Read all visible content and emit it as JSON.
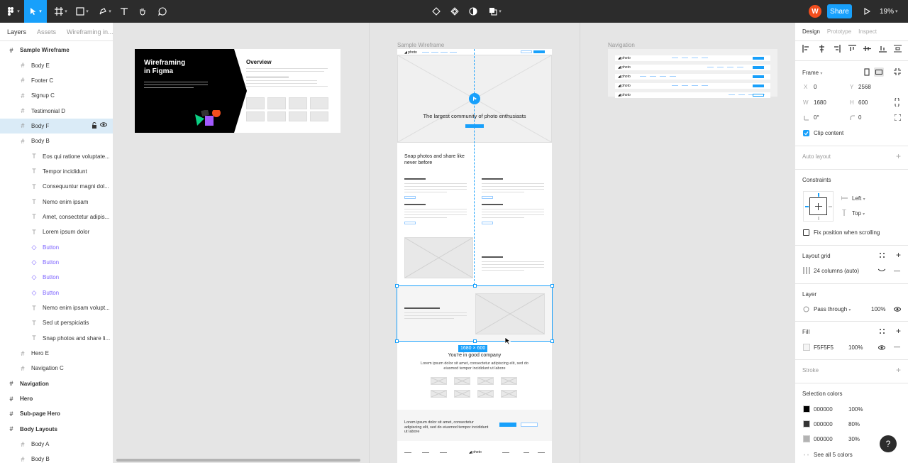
{
  "toolbar": {
    "avatar_initial": "W",
    "share_label": "Share",
    "zoom": "19%"
  },
  "left_panel": {
    "tabs": [
      "Layers",
      "Assets",
      "Wireframing in..."
    ],
    "layers": [
      {
        "name": "Sample Wireframe",
        "icon": "#",
        "kind": "top"
      },
      {
        "name": "Body E",
        "icon": "#",
        "kind": "frame"
      },
      {
        "name": "Footer C",
        "icon": "#",
        "kind": "frame"
      },
      {
        "name": "Signup C",
        "icon": "#",
        "kind": "frame"
      },
      {
        "name": "Testimonial D",
        "icon": "#",
        "kind": "frame"
      },
      {
        "name": "Body F",
        "icon": "#",
        "kind": "frame",
        "selected": true
      },
      {
        "name": "Body B",
        "icon": "#",
        "kind": "frame"
      },
      {
        "name": "Eos qui ratione voluptate...",
        "icon": "T",
        "kind": "text"
      },
      {
        "name": "Tempor incididunt",
        "icon": "T",
        "kind": "text"
      },
      {
        "name": "Consequuntur magni dol...",
        "icon": "T",
        "kind": "text"
      },
      {
        "name": "Nemo enim ipsam",
        "icon": "T",
        "kind": "text"
      },
      {
        "name": "Amet, consectetur adipis...",
        "icon": "T",
        "kind": "text"
      },
      {
        "name": "Lorem ipsum dolor",
        "icon": "T",
        "kind": "text"
      },
      {
        "name": "Button",
        "icon": "◇",
        "kind": "comp"
      },
      {
        "name": "Button",
        "icon": "◇",
        "kind": "comp"
      },
      {
        "name": "Button",
        "icon": "◇",
        "kind": "comp"
      },
      {
        "name": "Button",
        "icon": "◇",
        "kind": "comp"
      },
      {
        "name": "Nemo enim ipsam volupt...",
        "icon": "T",
        "kind": "text"
      },
      {
        "name": "Sed ut perspiciatis",
        "icon": "T",
        "kind": "text"
      },
      {
        "name": "Snap photos and share li...",
        "icon": "T",
        "kind": "text"
      },
      {
        "name": "Hero E",
        "icon": "#",
        "kind": "frame"
      },
      {
        "name": "Navigation C",
        "icon": "#",
        "kind": "frame"
      },
      {
        "name": "Navigation",
        "icon": "#",
        "kind": "top"
      },
      {
        "name": "Hero",
        "icon": "#",
        "kind": "top"
      },
      {
        "name": "Sub-page Hero",
        "icon": "#",
        "kind": "top"
      },
      {
        "name": "Body Layouts",
        "icon": "#",
        "kind": "top"
      },
      {
        "name": "Body A",
        "icon": "#",
        "kind": "frame"
      },
      {
        "name": "Body B",
        "icon": "#",
        "kind": "frame"
      }
    ]
  },
  "canvas": {
    "cover": {
      "title_line1": "Wireframing",
      "title_line2": "in Figma",
      "overview": "Overview"
    },
    "sample_label": "Sample Wireframe",
    "navigation_label": "Navigation",
    "nav_logos": [
      "photo",
      "photo",
      "photo",
      "photo",
      "photo"
    ],
    "hero_headline": "The largest community of photo enthusiasts",
    "snap_heading": "Snap photos and share like never before",
    "selection_size": "1680 × 600",
    "good_company": "You're in good company",
    "good_company_sub": "Lorem ipsum dolor sit amet, consectetur adipiscing elit, sed do eiusmod tempor incididunt ut labore",
    "signup_text": "Lorem ipsum dolor sit amet, consectetur adipiscing elit, sed do eiusmod tempor incididunt ut labore",
    "footer_logo": "photo"
  },
  "right_panel": {
    "tabs": [
      "Design",
      "Prototype",
      "Inspect"
    ],
    "frame_label": "Frame",
    "x": "0",
    "y": "2568",
    "w": "1680",
    "h": "600",
    "rotation": "0°",
    "radius": "0",
    "clip_content": "Clip content",
    "auto_layout": "Auto layout",
    "constraints": "Constraints",
    "constraint_h": "Left",
    "constraint_v": "Top",
    "fix_position": "Fix position when scrolling",
    "layout_grid": "Layout grid",
    "grid_value": "24 columns (auto)",
    "layer": "Layer",
    "blend": "Pass through",
    "layer_opacity": "100%",
    "fill": "Fill",
    "fill_hex": "F5F5F5",
    "fill_opacity": "100%",
    "stroke": "Stroke",
    "selection_colors": "Selection colors",
    "colors": [
      {
        "hex": "000000",
        "opacity": "100%",
        "color": "#000000"
      },
      {
        "hex": "000000",
        "opacity": "80%",
        "color": "#333333"
      },
      {
        "hex": "000000",
        "opacity": "30%",
        "color": "#b3b3b3"
      }
    ],
    "see_all": "See all 5 colors",
    "help": "?"
  }
}
